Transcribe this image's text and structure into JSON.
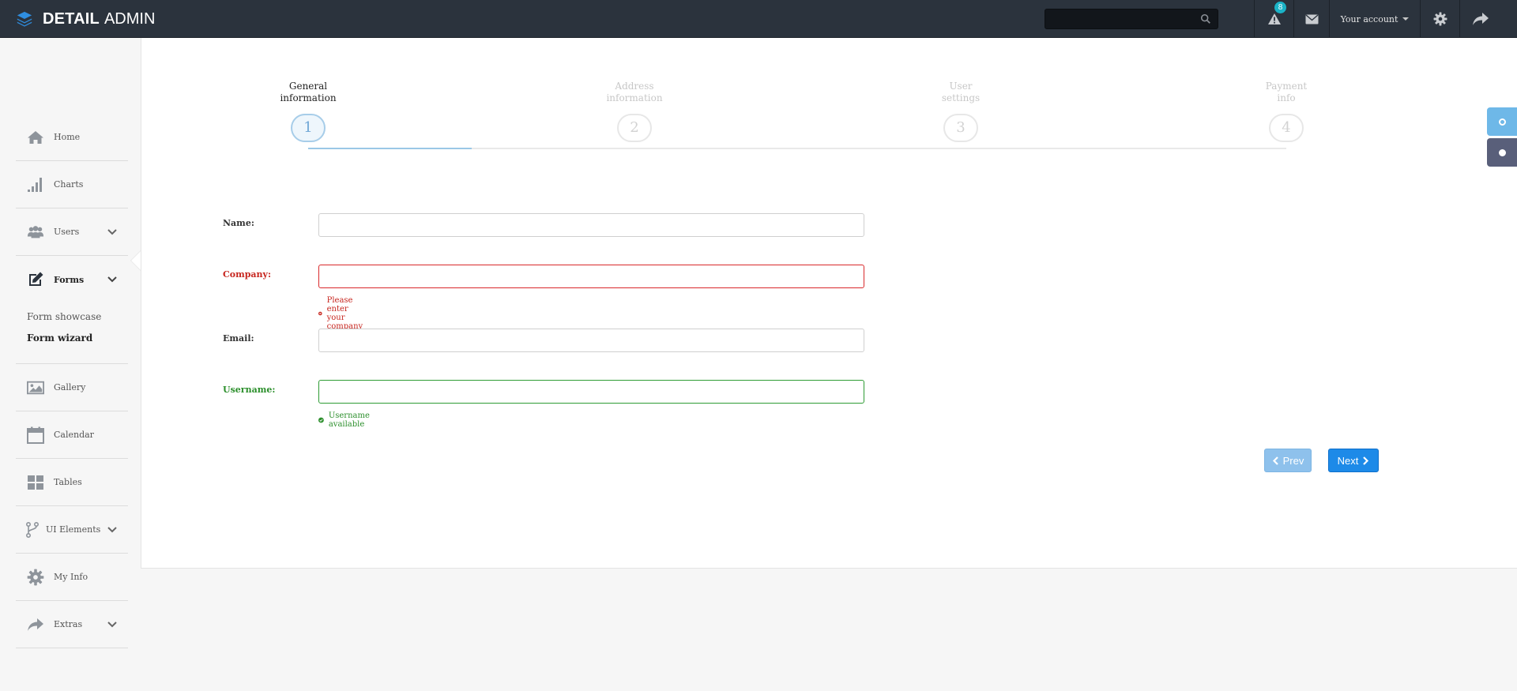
{
  "header": {
    "brand_bold": "DETAIL",
    "brand_light": "ADMIN",
    "search": {
      "placeholder": ""
    },
    "alerts_count": "8",
    "account_label": "Your account"
  },
  "sidebar": {
    "items": [
      {
        "label": "Home",
        "icon": "home-icon"
      },
      {
        "label": "Charts",
        "icon": "bar-chart-icon"
      },
      {
        "label": "Users",
        "icon": "users-icon",
        "has_submenu": true
      },
      {
        "label": "Forms",
        "icon": "edit-icon",
        "has_submenu": true,
        "active": true
      },
      {
        "label": "Gallery",
        "icon": "picture-icon"
      },
      {
        "label": "Calendar",
        "icon": "calendar-icon"
      },
      {
        "label": "Tables",
        "icon": "tables-icon"
      },
      {
        "label": "UI Elements",
        "icon": "fork-icon",
        "has_submenu": true
      },
      {
        "label": "My Info",
        "icon": "gear-icon"
      },
      {
        "label": "Extras",
        "icon": "share-icon",
        "has_submenu": true
      }
    ],
    "forms_sub": [
      {
        "label": "Form showcase"
      },
      {
        "label": "Form wizard",
        "current": true
      }
    ]
  },
  "wizard": {
    "steps": [
      {
        "label_line1": "General",
        "label_line2": "information",
        "number": "1",
        "current": true
      },
      {
        "label_line1": "Address",
        "label_line2": "information",
        "number": "2"
      },
      {
        "label_line1": "User",
        "label_line2": "settings",
        "number": "3"
      },
      {
        "label_line1": "Payment",
        "label_line2": "info",
        "number": "4"
      }
    ],
    "progress_fraction": 0.5
  },
  "form": {
    "name": {
      "label": "Name:",
      "value": ""
    },
    "company": {
      "label": "Company:",
      "value": "",
      "error": "Please enter your company"
    },
    "email": {
      "label": "Email:",
      "value": ""
    },
    "username": {
      "label": "Username:",
      "value": "",
      "success": "Username available"
    }
  },
  "buttons": {
    "prev": "Prev",
    "next": "Next"
  },
  "colors": {
    "topbar": "#2b333d",
    "accent": "#1d8ae8",
    "error": "#c7261f",
    "success": "#2c8f2c"
  }
}
